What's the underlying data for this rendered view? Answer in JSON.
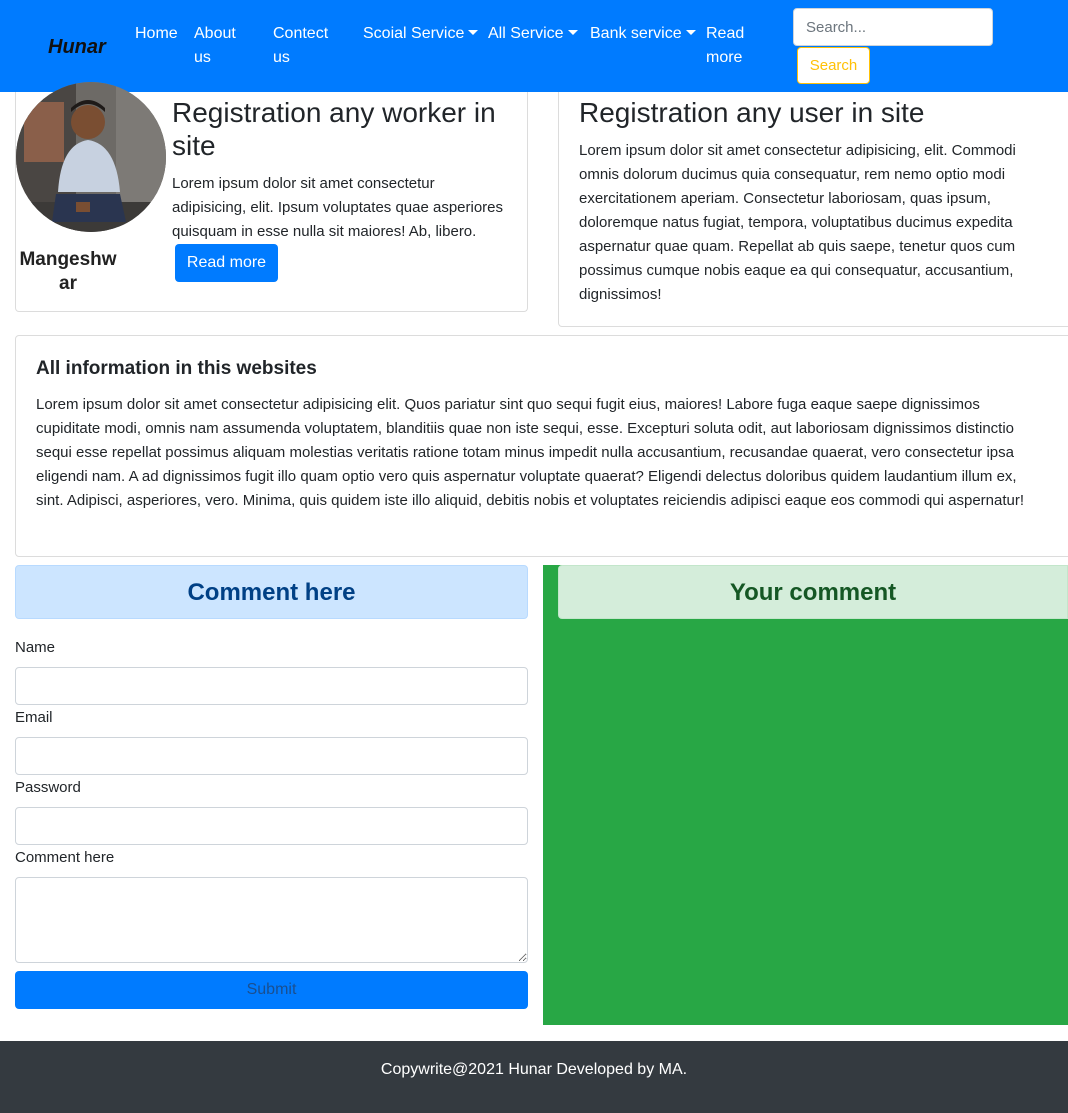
{
  "navbar": {
    "brand": "Hunar",
    "links": {
      "home": "Home",
      "about": "About us",
      "contact": "Contect us",
      "social": "Scoial Service",
      "all_service": "All Service",
      "bank": "Bank service",
      "read_more": "Read more"
    },
    "search": {
      "placeholder": "Search...",
      "button": "Search"
    },
    "colors": {
      "background": "#007bff",
      "search_accent": "#ffc107"
    }
  },
  "worker_card": {
    "name": "Mangeshwar",
    "avatar": "person-photo",
    "title": "Registration any worker in site",
    "text": "Lorem ipsum dolor sit amet consectetur adipisicing, elit. Ipsum voluptates quae asperiores quisquam in esse nulla sit maiores! Ab, libero.",
    "button": "Read more"
  },
  "user_card": {
    "title": "Registration any user in site",
    "text": "Lorem ipsum dolor sit amet consectetur adipisicing, elit. Commodi omnis dolorum ducimus quia consequatur, rem nemo optio modi exercitationem aperiam. Consectetur laboriosam, quas ipsum, doloremque natus fugiat, tempora, voluptatibus ducimus expedita aspernatur quae quam. Repellat ab quis saepe, tenetur quos cum possimus cumque nobis eaque ea qui consequatur, accusantium, dignissimos!"
  },
  "info_card": {
    "title": "All information in this websites",
    "text": "Lorem ipsum dolor sit amet consectetur adipisicing elit. Quos pariatur sint quo sequi fugit eius, maiores! Labore fuga eaque saepe dignissimos cupiditate modi, omnis nam assumenda voluptatem, blanditiis quae non iste sequi, esse. Excepturi soluta odit, aut laboriosam dignissimos distinctio sequi esse repellat possimus aliquam molestias veritatis ratione totam minus impedit nulla accusantium, recusandae quaerat, vero consectetur ipsa eligendi nam. A ad dignissimos fugit illo quam optio vero quis aspernatur voluptate quaerat? Eligendi delectus doloribus quidem laudantium illum ex, sint. Adipisci, asperiores, vero. Minima, quis quidem iste illo aliquid, debitis nobis et voluptates reiciendis adipisci eaque eos commodi qui aspernatur!"
  },
  "comment_form": {
    "header": "Comment here",
    "name_label": "Name",
    "email_label": "Email",
    "password_label": "Password",
    "comment_label": "Comment here",
    "submit": "Submit",
    "colors": {
      "header_bg": "#cce5ff",
      "header_text": "#004085",
      "submit_bg": "#007bff"
    }
  },
  "your_comment": {
    "header": "Your comment",
    "colors": {
      "panel_bg": "#28a745",
      "header_bg": "#d4edda",
      "header_text": "#155724"
    }
  },
  "footer": {
    "text": "Copywrite@2021 Hunar Developed by MA.",
    "colors": {
      "background": "#343a40"
    }
  }
}
